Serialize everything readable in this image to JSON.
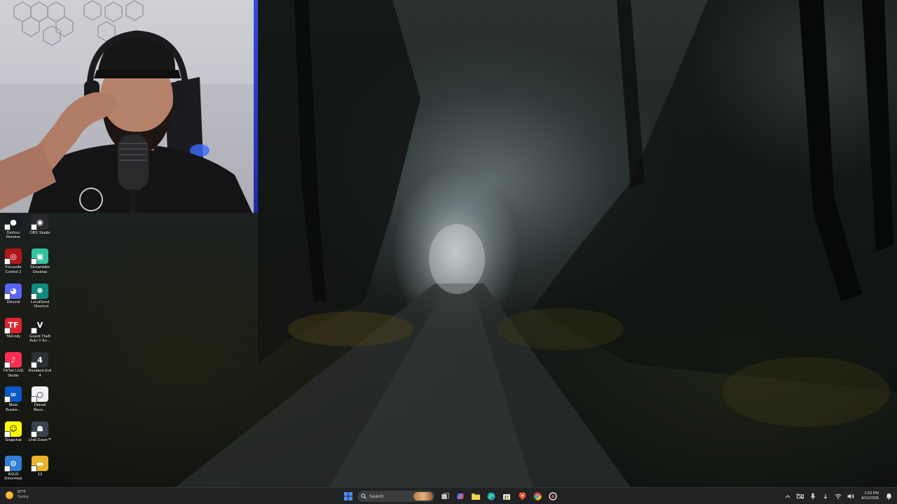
{
  "desktop": {
    "icons": [
      {
        "name": "DaVinci Resolve",
        "label": "DaVinci\nResolve",
        "color": "#1b1b24",
        "glyph": "●"
      },
      {
        "name": "OBS Studio",
        "label": "OBS Studio",
        "color": "#2a2a2e",
        "glyph": "◉"
      },
      {
        "name": "Focusrite Control 2",
        "label": "Focusrite\nControl 2",
        "color": "#b01818",
        "glyph": "◎"
      },
      {
        "name": "Streamlabs Desktop",
        "label": "Streamlabs\nDesktop",
        "color": "#32c3a2",
        "glyph": "▣"
      },
      {
        "name": "Discord",
        "label": "Discord",
        "color": "#5865f2",
        "glyph": "◕"
      },
      {
        "name": "LocalSend - Shortcut",
        "label": "LocalSend\n- Shortcut",
        "color": "#0f8a7e",
        "glyph": "✺"
      },
      {
        "name": "TikFinity",
        "label": "TikFinity",
        "color": "#e0242f",
        "glyph": "TF"
      },
      {
        "name": "Grand Theft Auto V Enhanced",
        "label": "Grand Theft\nAuto V En...",
        "color": "#1a1a1a",
        "glyph": "V"
      },
      {
        "name": "TikTok LIVE Studio",
        "label": "TikTok LIVE\nStudio",
        "color": "#fe2c55",
        "glyph": "♪"
      },
      {
        "name": "Resident Evil 4",
        "label": "Resident Evil\n4",
        "color": "#2c2f33",
        "glyph": "4"
      },
      {
        "name": "Meta Business Suite",
        "label": "Meta\nBusine...",
        "color": "#0a58ca",
        "glyph": "∞"
      },
      {
        "name": "Detroit Become Human",
        "label": "Detroit\nBeco...",
        "color": "#eef0f4",
        "glyph": "○"
      },
      {
        "name": "Snapchat",
        "label": "Snapchat",
        "color": "#fffc00",
        "glyph": "☺"
      },
      {
        "name": "Until Dawn",
        "label": "Until Dawn™",
        "color": "#3a4250",
        "glyph": "☗"
      },
      {
        "name": "ASUS DriverHub",
        "label": "ASUS\nDriverHub",
        "color": "#2f7fd6",
        "glyph": "⚙"
      },
      {
        "name": "13",
        "label": "13",
        "color": "#e8b52a",
        "glyph": "▬"
      }
    ]
  },
  "taskbar": {
    "weather": {
      "temp": "97°F",
      "condition": "Sunny"
    },
    "search": {
      "placeholder": "Search"
    },
    "clock": {
      "time": "2:53 PM",
      "date": "8/15/2026"
    },
    "pinned": [
      "start-button",
      "task-view",
      "copilot",
      "file-explorer",
      "edge",
      "store",
      "brave",
      "chrome",
      "capture-app"
    ]
  },
  "colors": {
    "taskbar_bg": "#202223",
    "accent_blue": "#4c8df6"
  }
}
